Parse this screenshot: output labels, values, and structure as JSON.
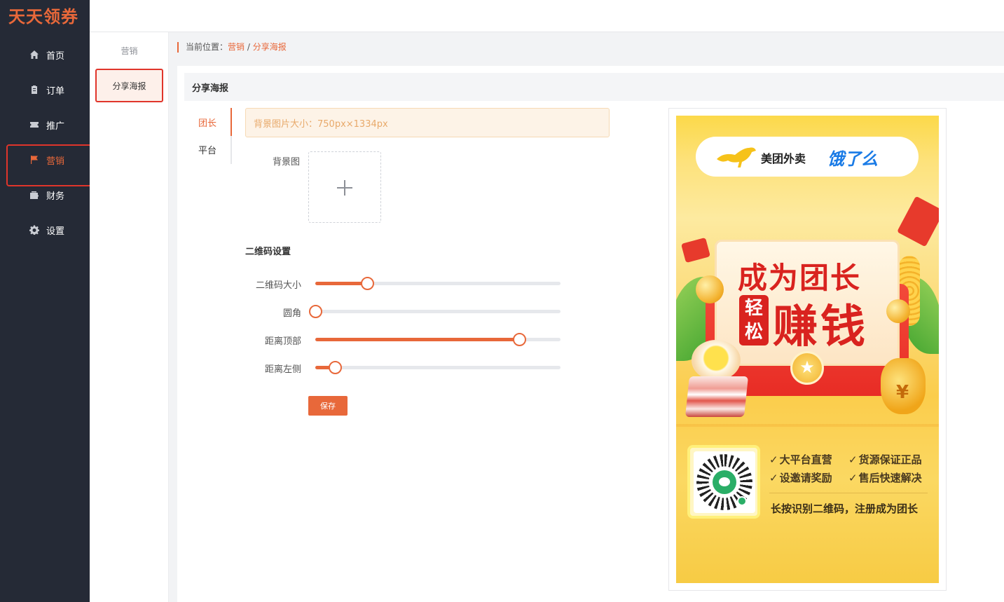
{
  "app": {
    "logo": "天天领券"
  },
  "sidebar": {
    "items": [
      {
        "label": "首页",
        "icon": "home-icon"
      },
      {
        "label": "订单",
        "icon": "clipboard-icon"
      },
      {
        "label": "推广",
        "icon": "ticket-icon"
      },
      {
        "label": "营销",
        "icon": "flag-icon",
        "active": true
      },
      {
        "label": "财务",
        "icon": "wallet-icon"
      },
      {
        "label": "设置",
        "icon": "gear-icon"
      }
    ]
  },
  "subnav": {
    "title": "营销",
    "items": [
      {
        "label": "分享海报",
        "active": true
      }
    ]
  },
  "breadcrumb": {
    "prefix": "当前位置：",
    "level1": "营销",
    "sep": " / ",
    "level2": "分享海报"
  },
  "card": {
    "title": "分享海报"
  },
  "tabs": [
    {
      "label": "团长",
      "active": true
    },
    {
      "label": "平台"
    }
  ],
  "form": {
    "tip": "背景图片大小：750px×1334px",
    "bg_label": "背景图",
    "qr_section_title": "二维码设置",
    "sliders": [
      {
        "label": "二维码大小",
        "value": 0.21
      },
      {
        "label": "圆角",
        "value": 0.0
      },
      {
        "label": "距离顶部",
        "value": 0.83
      },
      {
        "label": "距离左侧",
        "value": 0.08
      }
    ],
    "save_label": "保存"
  },
  "poster": {
    "brand_meituan": "美团外卖",
    "brand_eleme": "饿了么",
    "headline_line1": "成为团长",
    "headline_small": "轻松",
    "headline_line2": "赚钱",
    "medal_symbol": "★",
    "bag_symbol": "¥",
    "features": [
      "大平台直营",
      "货源保证正品",
      "设邀请奖励",
      "售后快速解决"
    ],
    "scan_text": "长按识别二维码，注册成为团长"
  },
  "colors": {
    "accent": "#e8683a",
    "sidebar_bg": "#252a36",
    "highlight_border": "#e0352b"
  }
}
